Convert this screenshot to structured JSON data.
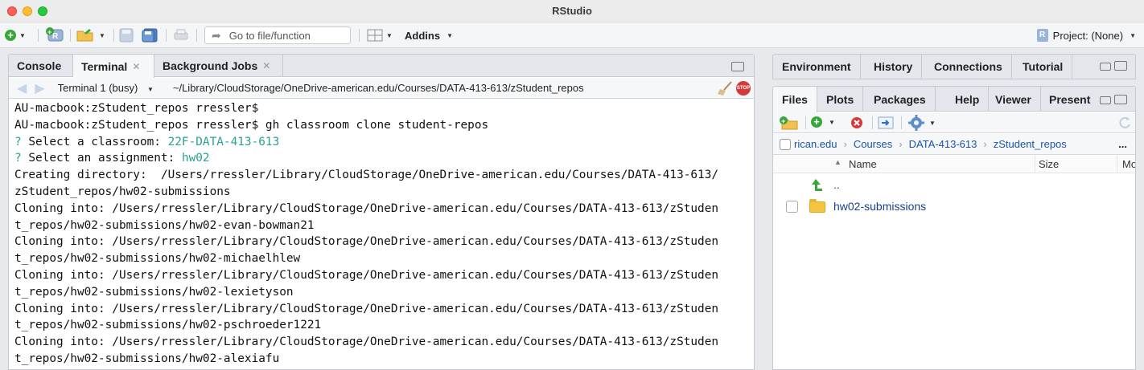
{
  "window": {
    "title": "RStudio"
  },
  "toolbar": {
    "goto_placeholder": "Go to file/function",
    "addins_label": "Addins",
    "project_label": "Project: (None)"
  },
  "left_pane": {
    "tabs": [
      {
        "label": "Console",
        "closable": false
      },
      {
        "label": "Terminal",
        "closable": true,
        "active": true
      },
      {
        "label": "Background Jobs",
        "closable": true
      }
    ],
    "terminal_selector": "Terminal 1 (busy)",
    "path": "~/Library/CloudStorage/OneDrive-american.edu/Courses/DATA-413-613/zStudent_repos",
    "stop_label": "STOP",
    "lines": {
      "l1": "AU-macbook:zStudent_repos rressler$",
      "l2": "AU-macbook:zStudent_repos rressler$ gh classroom clone student-repos",
      "l3_prefix": "? ",
      "l3_text": "Select a classroom: ",
      "l3_value": "22F-DATA-413-613",
      "l4_prefix": "? ",
      "l4_text": "Select an assignment: ",
      "l4_value": "hw02",
      "l5": "Creating directory:  /Users/rressler/Library/CloudStorage/OneDrive-american.edu/Courses/DATA-413-613/",
      "l6": "zStudent_repos/hw02-submissions",
      "l7": "Cloning into: /Users/rressler/Library/CloudStorage/OneDrive-american.edu/Courses/DATA-413-613/zStuden",
      "l8": "t_repos/hw02-submissions/hw02-evan-bowman21",
      "l9": "Cloning into: /Users/rressler/Library/CloudStorage/OneDrive-american.edu/Courses/DATA-413-613/zStuden",
      "l10": "t_repos/hw02-submissions/hw02-michaelhlew",
      "l11": "Cloning into: /Users/rressler/Library/CloudStorage/OneDrive-american.edu/Courses/DATA-413-613/zStuden",
      "l12": "t_repos/hw02-submissions/hw02-lexietyson",
      "l13": "Cloning into: /Users/rressler/Library/CloudStorage/OneDrive-american.edu/Courses/DATA-413-613/zStuden",
      "l14": "t_repos/hw02-submissions/hw02-pschroeder1221",
      "l15": "Cloning into: /Users/rressler/Library/CloudStorage/OneDrive-american.edu/Courses/DATA-413-613/zStuden",
      "l16": "t_repos/hw02-submissions/hw02-alexiafu"
    }
  },
  "right_upper": {
    "tabs": [
      "Environment",
      "History",
      "Connections",
      "Tutorial"
    ]
  },
  "right_lower": {
    "tabs": [
      "Files",
      "Plots",
      "Packages",
      "Help",
      "Viewer",
      "Present"
    ],
    "breadcrumb": [
      "rican.edu",
      "Courses",
      "DATA-413-613",
      "zStudent_repos"
    ],
    "more": "...",
    "columns": {
      "name": "Name",
      "size": "Size",
      "modified": "Mod"
    },
    "up_label": "..",
    "files": [
      {
        "name": "hw02-submissions",
        "type": "folder"
      }
    ]
  },
  "colors": {
    "accent_teal": "#2aa198",
    "link_blue": "#1a54a6",
    "stop_red": "#d43a3a"
  }
}
